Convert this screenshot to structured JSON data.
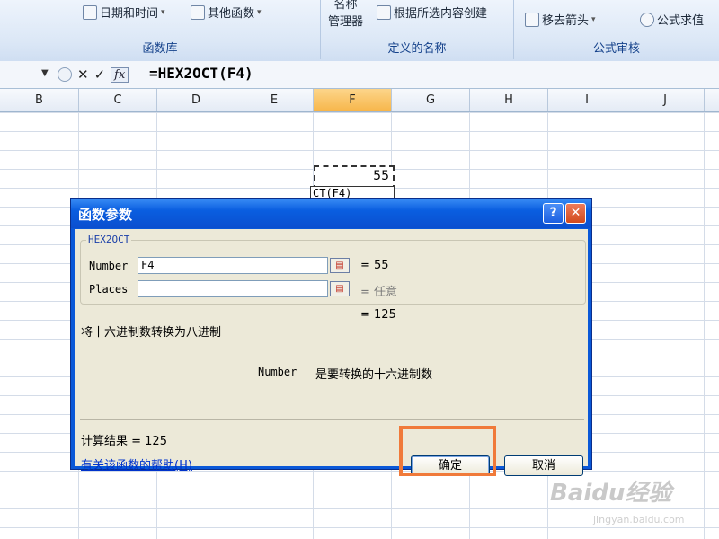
{
  "ribbon": {
    "datetime_label": "日期和时间",
    "other_functions_label": "其他函数",
    "function_library_label": "函数库",
    "name_manager_top": "名称",
    "name_manager_label": "管理器",
    "create_from_selection_label": "根据所选内容创建",
    "defined_names_label": "定义的名称",
    "remove_arrows_label": "移去箭头",
    "evaluate_formula_label": "公式求值",
    "formula_auditing_label": "公式审核"
  },
  "formula_bar": {
    "cancel_glyph": "✕",
    "enter_glyph": "✓",
    "fx_label": "fx",
    "formula": "=HEX2OCT(F4)"
  },
  "columns": [
    "B",
    "C",
    "D",
    "E",
    "F",
    "G",
    "H",
    "I",
    "J"
  ],
  "selected_column": "F",
  "cell": {
    "value": "55",
    "partial_text": "CT(F4)"
  },
  "dialog": {
    "title": "函数参数",
    "help_glyph": "?",
    "close_glyph": "✕",
    "function_name": "HEX2OCT",
    "args": [
      {
        "label": "Number",
        "value": "F4",
        "result": "= 55"
      },
      {
        "label": "Places",
        "value": "",
        "result": "= 任意"
      }
    ],
    "formula_result_line": "= 125",
    "description": "将十六进制数转换为八进制",
    "arg_desc_name": "Number",
    "arg_desc_text": "是要转换的十六进制数",
    "calc_result": "计算结果 =  125",
    "help_link": "有关该函数的帮助(H)",
    "ok_label": "确定",
    "cancel_label": "取消"
  },
  "watermark": {
    "brand": "Baidu经验",
    "url": "jingyan.baidu.com"
  },
  "colors": {
    "highlight": "#f07a3a",
    "dialog_title": "#0a58d8",
    "dialog_body": "#ece9d8"
  }
}
